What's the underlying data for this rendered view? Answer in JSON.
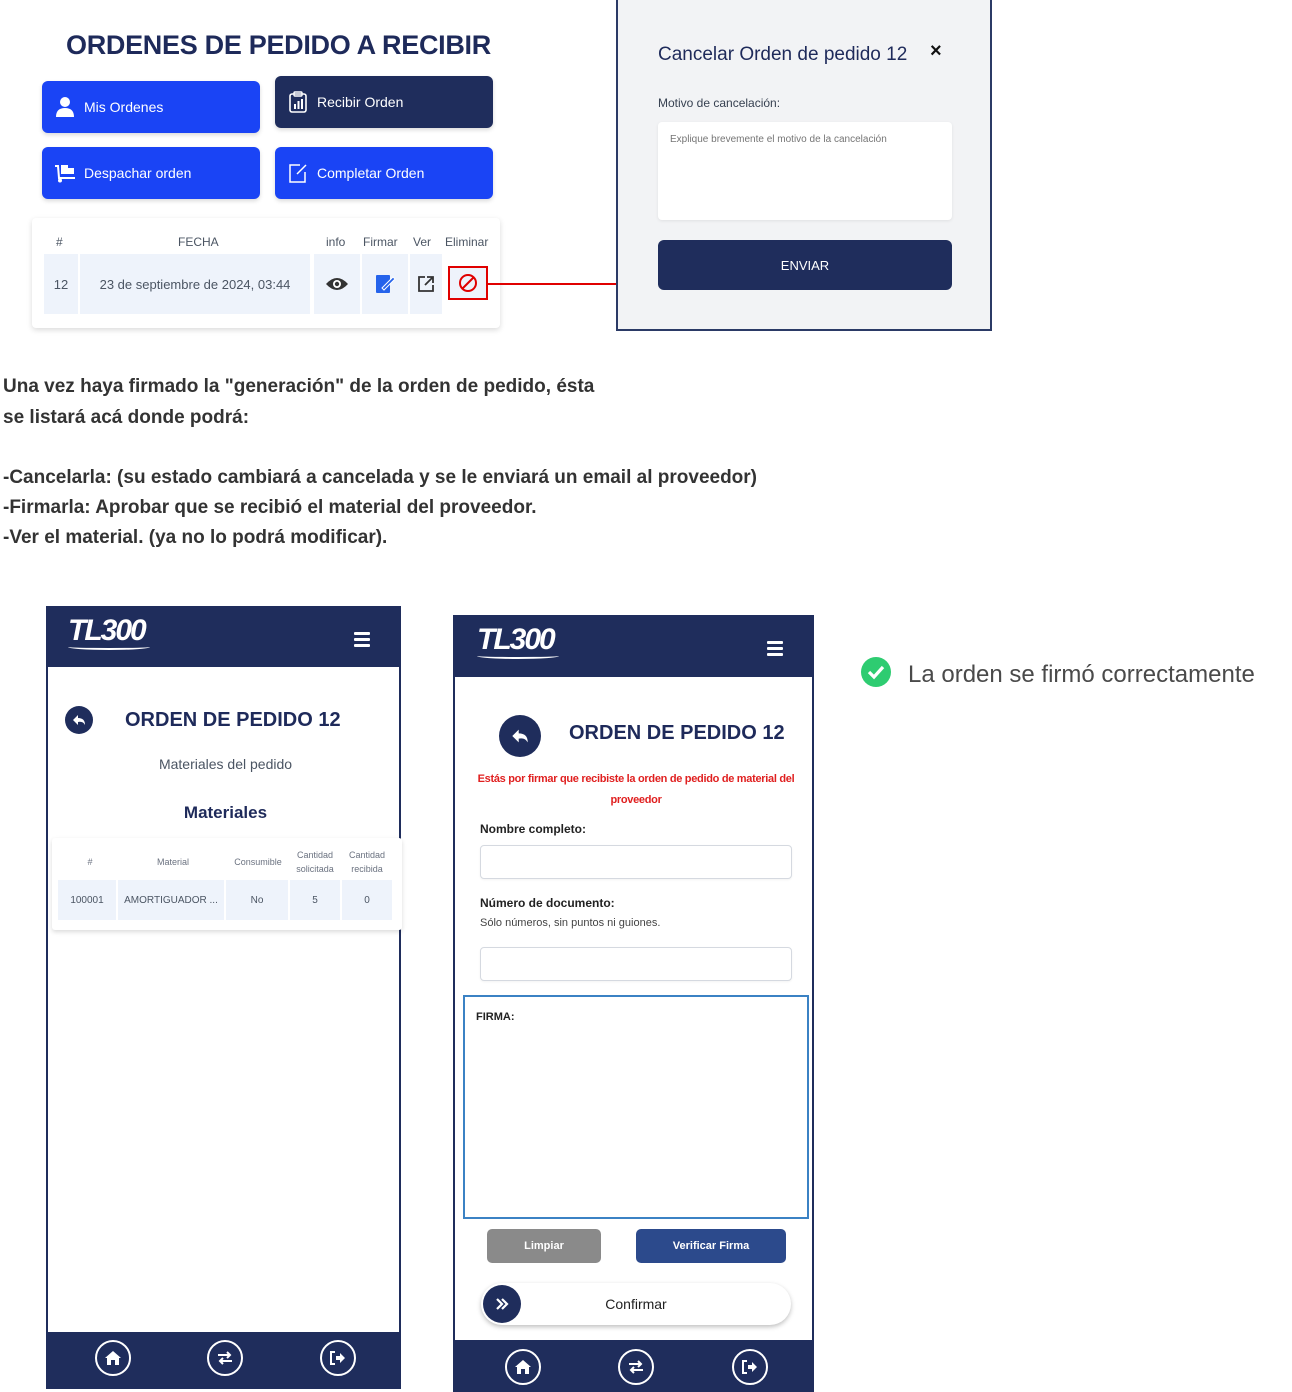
{
  "orders_panel": {
    "title": "ORDENES DE PEDIDO A RECIBIR",
    "buttons": {
      "mis_ordenes": "Mis Ordenes",
      "recibir_orden": "Recibir Orden",
      "despachar_orden": "Despachar orden",
      "completar_orden": "Completar Orden"
    },
    "table": {
      "headers": [
        "#",
        "FECHA",
        "info",
        "Firmar",
        "Ver",
        "Eliminar"
      ],
      "row": {
        "id": "12",
        "fecha": "23 de septiembre de 2024, 03:44"
      }
    },
    "colors": {
      "primary_blue": "#1a44f5",
      "navy": "#1f2d5c",
      "highlight": "#e00000"
    }
  },
  "cancel_modal": {
    "title": "Cancelar Orden de pedido 12",
    "close": "×",
    "label": "Motivo de cancelación:",
    "placeholder": "Explique brevemente el motivo de la cancelación",
    "send": "ENVIAR"
  },
  "instructions": {
    "line1": "Una vez haya firmado la \"generación\" de la orden de pedido, ésta",
    "line2": "se listará acá donde podrá:",
    "line3": "-Cancelarla: (su estado cambiará a cancelada y se le enviará un email al proveedor)",
    "line4": "-Firmarla:  Aprobar que se recibió el material del proveedor.",
    "line5": "-Ver el material. (ya no lo podrá modificar)."
  },
  "phone1": {
    "logo": "TL300",
    "title": "ORDEN DE PEDIDO 12",
    "subtitle": "Materiales del pedido",
    "section": "Materiales",
    "table": {
      "headers": {
        "num": "#",
        "material": "Material",
        "consumible": "Consumible",
        "solicitada_1": "Cantidad",
        "solicitada_2": "solicitada",
        "recibida_1": "Cantidad",
        "recibida_2": "recibida"
      },
      "row": {
        "num": "100001",
        "material": "AMORTIGUADOR ...",
        "consumible": "No",
        "solicitada": "5",
        "recibida": "0"
      }
    },
    "footer_icons": [
      "home-icon",
      "swap-icon",
      "logout-icon"
    ]
  },
  "phone2": {
    "logo": "TL300",
    "title": "ORDEN DE PEDIDO 12",
    "warning": "Estás por firmar que recibiste la orden de pedido de material del proveedor",
    "nombre_label": "Nombre completo:",
    "documento_label": "Número de documento:",
    "documento_hint": "Sólo números, sin puntos ni guiones.",
    "firma_label": "FIRMA:",
    "limpiar": "Limpiar",
    "verificar": "Verificar Firma",
    "confirmar": "Confirmar",
    "warning_color": "#e02020"
  },
  "toast": {
    "text": "La orden se firmó correctamente",
    "color": "#2ecc71"
  }
}
